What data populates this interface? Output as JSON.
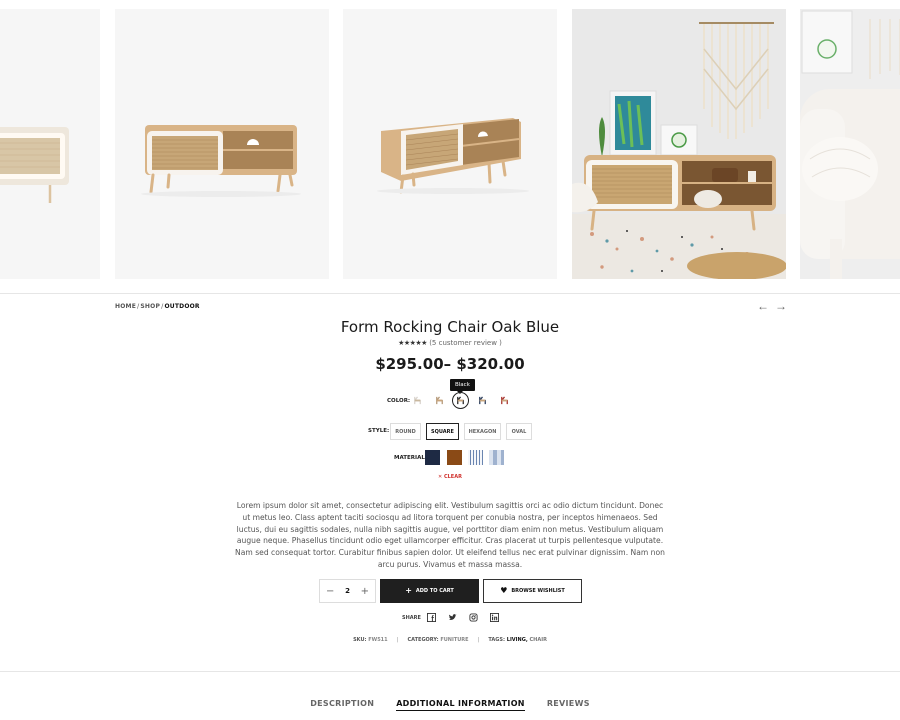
{
  "breadcrumb": {
    "home": "HOME",
    "shop": "SHOP",
    "current": "OUTDOOR",
    "sep": "/"
  },
  "nav": {
    "prev_icon": "←",
    "next_icon": "→"
  },
  "product": {
    "title": "Form Rocking Chair Oak Blue",
    "rating_stars": "★★★★★",
    "rating_text": "(5 customer review )",
    "rating_value": 4,
    "price": "$295.00– $320.00"
  },
  "color": {
    "label": "COLOR:",
    "tooltip": "Black",
    "options": [
      {
        "name": "White",
        "hex": "#d9d4ce",
        "selected": false
      },
      {
        "name": "Beige",
        "hex": "#b59a7a",
        "selected": false
      },
      {
        "name": "Black",
        "hex": "#2a2a2a",
        "selected": true
      },
      {
        "name": "Navy",
        "hex": "#2c3e5c",
        "selected": false
      },
      {
        "name": "Red",
        "hex": "#a8322c",
        "selected": false
      }
    ]
  },
  "style": {
    "label": "STYLE:",
    "options": [
      {
        "label": "ROUND",
        "selected": false
      },
      {
        "label": "SQUARE",
        "selected": true
      },
      {
        "label": "HEXAGON",
        "selected": false
      },
      {
        "label": "OVAL",
        "selected": false
      }
    ]
  },
  "material": {
    "label": "MATERIAL:",
    "options": [
      {
        "name": "Navy fabric",
        "color": "#1e2a44"
      },
      {
        "name": "Walnut",
        "color": "#8a4a16"
      },
      {
        "name": "Stripe",
        "color": "#c9d6e6"
      },
      {
        "name": "Check",
        "color": "#b8c6dc"
      }
    ]
  },
  "clear": {
    "icon": "✕",
    "label": "CLEAR"
  },
  "description": "Lorem ipsum dolor sit amet, consectetur adipiscing elit. Vestibulum sagittis orci ac odio dictum tincidunt. Donec ut metus leo. Class aptent taciti sociosqu ad litora torquent per conubia nostra, per inceptos himenaeos. Sed luctus, dui eu sagittis sodales, nulla nibh sagittis augue, vel porttitor diam enim non metus. Vestibulum aliquam augue neque. Phasellus tincidunt odio eget ullamcorper efficitur. Cras placerat ut turpis pellentesque vulputate. Nam sed consequat tortor. Curabitur finibus sapien dolor. Ut eleifend tellus nec erat pulvinar dignissim. Nam non arcu purus. Vivamus et massa massa.",
  "quantity": {
    "value": "2",
    "minus": "−",
    "plus": "+"
  },
  "cart": {
    "icon": "+",
    "label": "ADD TO CART"
  },
  "wishlist": {
    "icon": "♥",
    "label": "BROWSE WISHLIST"
  },
  "share": {
    "label": "SHARE",
    "icons": [
      "facebook-icon",
      "twitter-icon",
      "instagram-icon",
      "linkedin-icon"
    ]
  },
  "meta": {
    "sku_label": "SKU:",
    "sku": "FW511",
    "category_label": "CATEGORY:",
    "category": "FUNITURE",
    "tags_label": "TAGS:",
    "tag1": "LIVING,",
    "tag2": "CHAIR",
    "sep": "|"
  },
  "tabs": [
    {
      "label": "DESCRIPTION",
      "active": false
    },
    {
      "label": "ADDITIONAL INFORMATION",
      "active": true
    },
    {
      "label": "REVIEWS",
      "active": false
    }
  ],
  "colors": {
    "accent": "#111111",
    "clear": "#d0312d",
    "cane": "#c9a77a",
    "wood": "#d9b487"
  }
}
